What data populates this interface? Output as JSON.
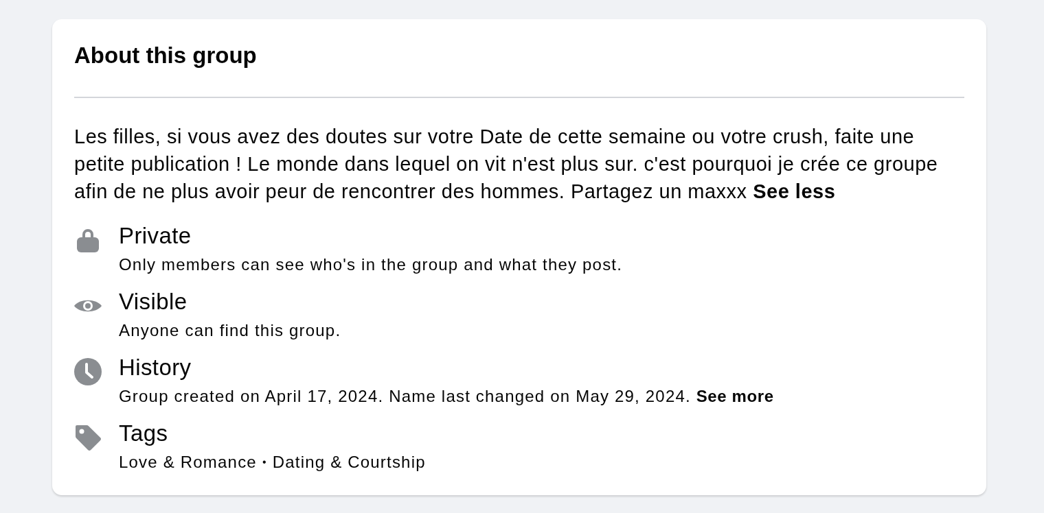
{
  "card": {
    "title": "About this group"
  },
  "description": {
    "text": "Les filles, si vous avez des doutes sur votre Date de cette semaine ou votre crush, faite une petite publication ! Le monde dans lequel on vit n'est plus sur. c'est pourquoi je crée ce groupe afin de ne plus avoir peur de rencontrer des hommes. Partagez un maxxx",
    "toggle": "See less"
  },
  "items": [
    {
      "kind": "privacy",
      "title": "Private",
      "text": "Only members can see who's in the group and what they post."
    },
    {
      "kind": "visibility",
      "title": "Visible",
      "text": "Anyone can find this group."
    },
    {
      "kind": "history",
      "title": "History",
      "text": "Group created on April 17, 2024. Name last changed on May 29, 2024.",
      "link": "See more"
    },
    {
      "kind": "tags",
      "title": "Tags",
      "tags": [
        "Love & Romance",
        "Dating & Courtship"
      ],
      "separator": "•"
    }
  ]
}
